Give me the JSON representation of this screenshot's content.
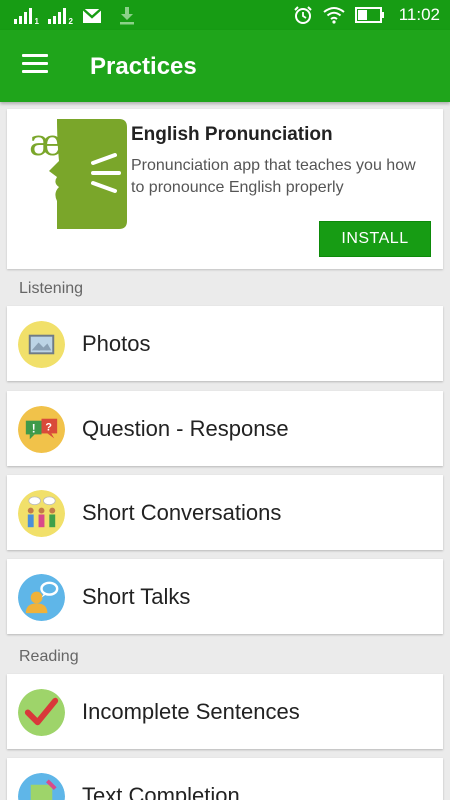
{
  "status_bar": {
    "time": "11:02",
    "signal1_label": "1",
    "signal2_label": "2"
  },
  "app_bar": {
    "title": "Practices"
  },
  "ad": {
    "title": "English Pronunciation",
    "description": "Pronunciation app that teaches you how to pronounce English properly",
    "install_label": "INSTALL",
    "icon_glyph": "æ"
  },
  "sections": {
    "listening": "Listening",
    "reading": "Reading"
  },
  "items": {
    "photos": "Photos",
    "question_response": "Question - Response",
    "short_conversations": "Short Conversations",
    "short_talks": "Short Talks",
    "incomplete_sentences": "Incomplete Sentences",
    "text_completion": "Text Completion"
  },
  "colors": {
    "status_bar": "#179c14",
    "app_bar": "#1fa51b",
    "install_button": "#179c14",
    "background": "#ebebeb"
  }
}
